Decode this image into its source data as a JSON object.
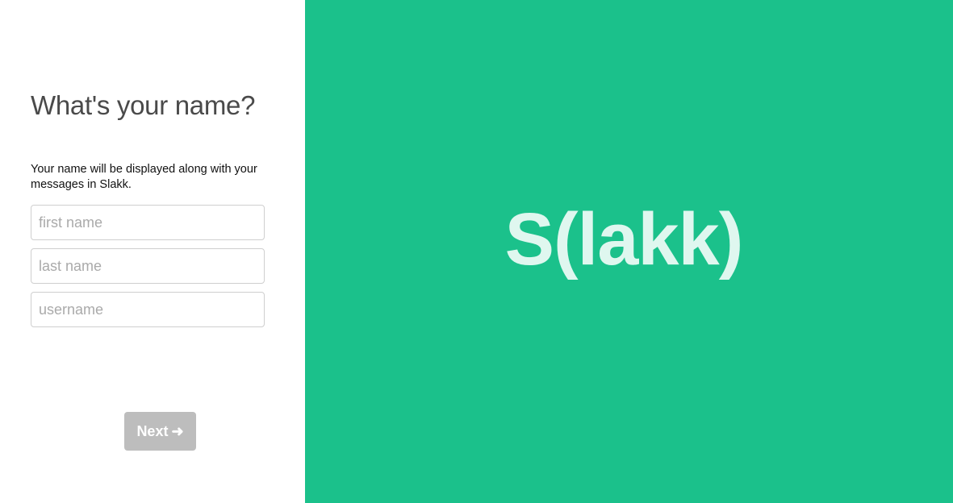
{
  "signup": {
    "title": "What's your name?",
    "description": "Your name will be displayed along with your messages in Slakk.",
    "fields": {
      "first_name_placeholder": "first name",
      "last_name_placeholder": "last name",
      "username_placeholder": "username"
    },
    "next_label": "Next",
    "next_icon": "arrow-right-icon"
  },
  "brand": {
    "logo_text": "S(lakk)",
    "panel_color": "#1bc18b",
    "logo_color": "#dff7ef"
  }
}
